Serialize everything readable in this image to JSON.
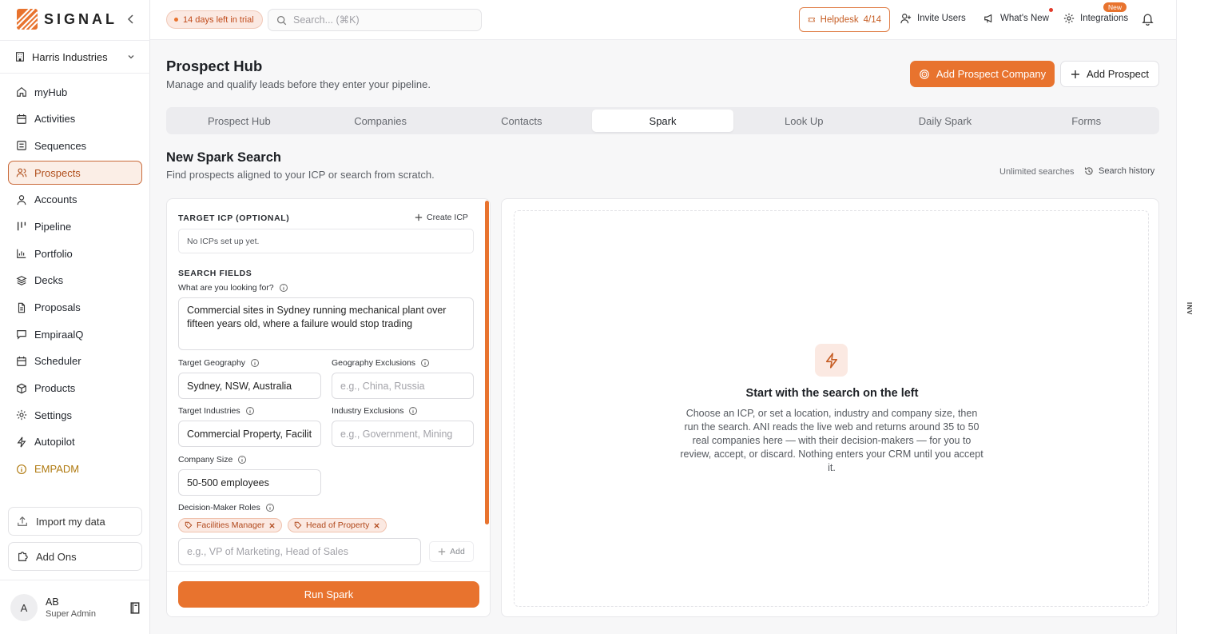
{
  "app": {
    "logo_text": "SIGNAL",
    "accent": "#e8732e"
  },
  "sidebar": {
    "org": "Harris Industries",
    "items": [
      {
        "label": "myHub",
        "icon": "home-icon"
      },
      {
        "label": "Activities",
        "icon": "calendar-icon"
      },
      {
        "label": "Sequences",
        "icon": "list-icon"
      },
      {
        "label": "Prospects",
        "icon": "users-icon",
        "active": true
      },
      {
        "label": "Accounts",
        "icon": "user-icon"
      },
      {
        "label": "Pipeline",
        "icon": "columns-icon"
      },
      {
        "label": "Portfolio",
        "icon": "bar-chart-icon"
      },
      {
        "label": "Decks",
        "icon": "layers-icon"
      },
      {
        "label": "Proposals",
        "icon": "file-icon"
      },
      {
        "label": "EmpiraalQ",
        "icon": "message-icon"
      },
      {
        "label": "Scheduler",
        "icon": "calendar-icon"
      },
      {
        "label": "Products",
        "icon": "box-icon"
      },
      {
        "label": "Settings",
        "icon": "gear-icon"
      },
      {
        "label": "Autopilot",
        "icon": "zap-icon"
      },
      {
        "label": "EMPADM",
        "icon": "info-icon"
      }
    ],
    "import_label": "Import my data",
    "addons_label": "Add Ons",
    "user": {
      "initial": "A",
      "name": "AB",
      "role": "Super Admin"
    }
  },
  "topbar": {
    "trial": "14 days left in trial",
    "search_placeholder": "Search... (⌘K)",
    "helpdesk_label": "Helpdesk",
    "helpdesk_count": "4/14",
    "invite": "Invite Users",
    "whats_new": "What's New",
    "integrations": "Integrations",
    "new_badge": "New"
  },
  "page": {
    "title": "Prospect Hub",
    "subtitle": "Manage and qualify leads before they enter your pipeline.",
    "add_company": "Add Prospect Company",
    "add_prospect": "Add Prospect",
    "tabs": [
      "Prospect Hub",
      "Companies",
      "Contacts",
      "Spark",
      "Look Up",
      "Daily Spark",
      "Forms"
    ],
    "active_tab": "Spark"
  },
  "spark": {
    "title": "New Spark Search",
    "subtitle": "Find prospects aligned to your ICP or search from scratch.",
    "unlimited": "Unlimited searches",
    "history": "Search history",
    "icp_label": "TARGET ICP (OPTIONAL)",
    "create_icp": "Create ICP",
    "icp_empty": "No ICPs set up yet.",
    "fields_label": "SEARCH FIELDS",
    "looking_for_label": "What are you looking for?",
    "looking_for_value": "Commercial sites in Sydney running mechanical plant over fifteen years old, where a failure would stop trading",
    "geo_label": "Target Geography",
    "geo_value": "Sydney, NSW, Australia",
    "geo_ex_label": "Geography Exclusions",
    "geo_ex_placeholder": "e.g., China, Russia",
    "ind_label": "Target Industries",
    "ind_value": "Commercial Property, Facilit",
    "ind_ex_label": "Industry Exclusions",
    "ind_ex_placeholder": "e.g., Government, Mining",
    "size_label": "Company Size",
    "size_value": "50-500 employees",
    "roles_label": "Decision-Maker Roles",
    "roles": [
      "Facilities Manager",
      "Head of Property"
    ],
    "role_placeholder": "e.g., VP of Marketing, Head of Sales",
    "add_label": "Add",
    "run_label": "Run Spark"
  },
  "results": {
    "empty_title": "Start with the search on the left",
    "empty_body": "Choose an ICP, or set a location, industry and company size, then run the search. ANI reads the live web and returns around 35 to 50 real companies here — with their decision-makers — for you to review, accept, or discard. Nothing enters your CRM until you accept it."
  },
  "side_tag": "INV"
}
